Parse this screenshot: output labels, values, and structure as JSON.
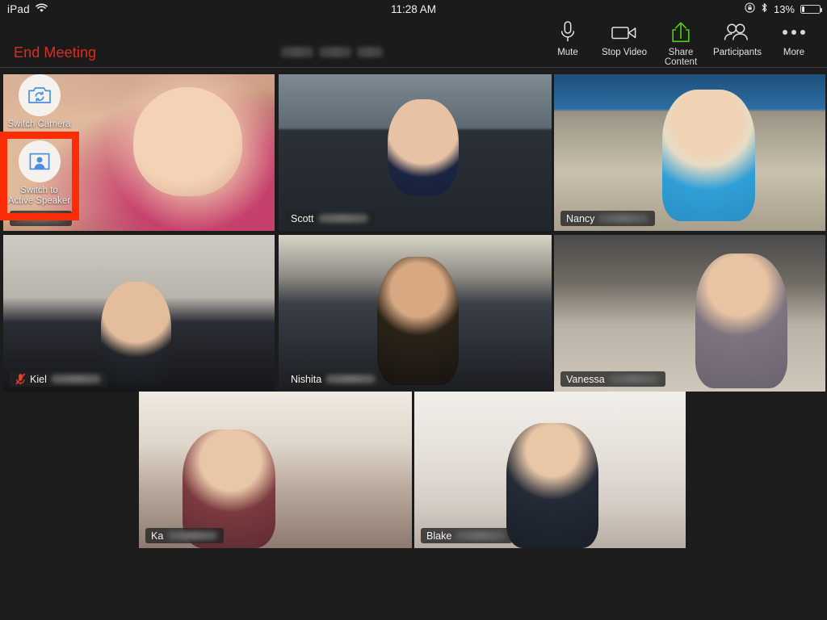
{
  "status_bar": {
    "carrier": "iPad",
    "wifi_icon": "wifi-icon",
    "time": "11:28 AM",
    "rotation_lock_icon": "rotation-lock-icon",
    "bluetooth_icon": "bluetooth-icon",
    "battery_percent": "13%",
    "battery_level": 13
  },
  "toolbar": {
    "end_meeting_label": "End Meeting",
    "end_meeting_color": "#e02b20",
    "meeting_id_redacted": true,
    "items": [
      {
        "label": "Mute",
        "icon": "microphone-icon"
      },
      {
        "label": "Stop Video",
        "icon": "video-camera-icon"
      },
      {
        "label": "Share Content",
        "icon": "share-upload-icon",
        "color": "#4fd019"
      },
      {
        "label": "Participants",
        "icon": "participants-icon"
      },
      {
        "label": "More",
        "icon": "ellipsis-icon"
      }
    ]
  },
  "self_view_controls": {
    "switch_camera": {
      "label": "Switch Camera",
      "icon": "switch-camera-icon"
    },
    "switch_active_speaker": {
      "label": "Switch to\nActive Speaker",
      "line1": "Switch to",
      "line2": "Active Speaker",
      "icon": "active-speaker-icon",
      "highlighted": true
    }
  },
  "annotation": {
    "type": "highlight-rectangle",
    "color": "#fc2d06",
    "target": "switch-to-active-speaker-button"
  },
  "gallery": {
    "active_speaker_border_color": "#63d62b",
    "participants": [
      {
        "name": "",
        "name_redacted": true,
        "muted": false,
        "active_speaker": false,
        "feed": "f-self",
        "self_view": true
      },
      {
        "name": "Scott",
        "name_redacted": true,
        "muted": false,
        "active_speaker": false,
        "feed": "f-scott"
      },
      {
        "name": "Nancy",
        "name_redacted": true,
        "muted": false,
        "active_speaker": true,
        "feed": "f-nancy"
      },
      {
        "name": "Kiel",
        "name_redacted": true,
        "muted": true,
        "active_speaker": false,
        "feed": "f-kiel"
      },
      {
        "name": "Nishita",
        "name_redacted": true,
        "muted": false,
        "active_speaker": false,
        "feed": "f-nishita"
      },
      {
        "name": "Vanessa",
        "name_redacted": true,
        "muted": false,
        "active_speaker": false,
        "feed": "f-vanessa"
      },
      {
        "name": "Ka",
        "name_redacted": true,
        "muted": false,
        "active_speaker": false,
        "feed": "f-kat"
      },
      {
        "name": "Blake",
        "name_redacted": true,
        "muted": false,
        "active_speaker": false,
        "feed": "f-blake"
      }
    ]
  }
}
